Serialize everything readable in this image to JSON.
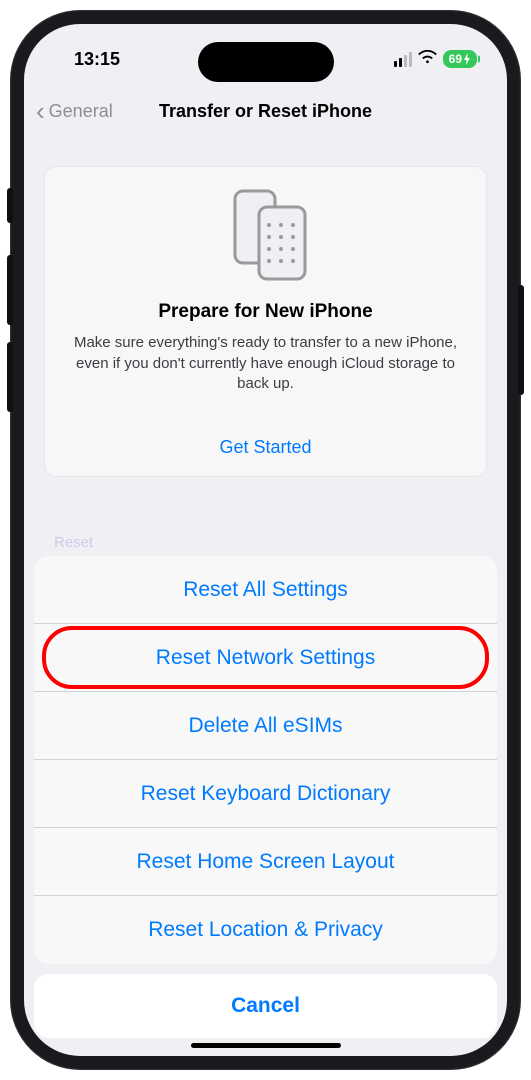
{
  "status": {
    "time": "13:15",
    "battery": "69"
  },
  "nav": {
    "back_label": "General",
    "title": "Transfer or Reset iPhone"
  },
  "prepare": {
    "title": "Prepare for New iPhone",
    "description": "Make sure everything's ready to transfer to a new iPhone, even if you don't currently have enough iCloud storage to back up.",
    "cta": "Get Started"
  },
  "reset_hint": "Reset",
  "sheet": {
    "items": [
      {
        "label": "Reset All Settings"
      },
      {
        "label": "Reset Network Settings",
        "highlighted": true
      },
      {
        "label": "Delete All eSIMs"
      },
      {
        "label": "Reset Keyboard Dictionary"
      },
      {
        "label": "Reset Home Screen Layout"
      },
      {
        "label": "Reset Location & Privacy"
      }
    ],
    "cancel": "Cancel"
  }
}
